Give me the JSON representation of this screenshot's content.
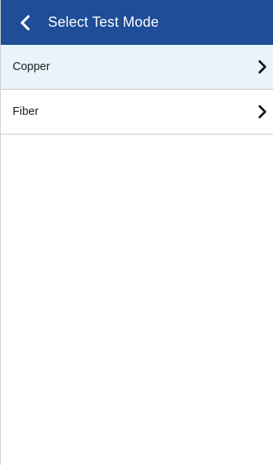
{
  "header": {
    "title": "Select Test Mode",
    "back_icon": "chevron-left-icon",
    "background_color": "#1f4d97"
  },
  "list": {
    "items": [
      {
        "label": "Copper",
        "icon": "chevron-right-icon",
        "selected": true
      },
      {
        "label": "Fiber",
        "icon": "chevron-right-icon",
        "selected": false
      }
    ],
    "selected_color": "#e8f3fc"
  }
}
